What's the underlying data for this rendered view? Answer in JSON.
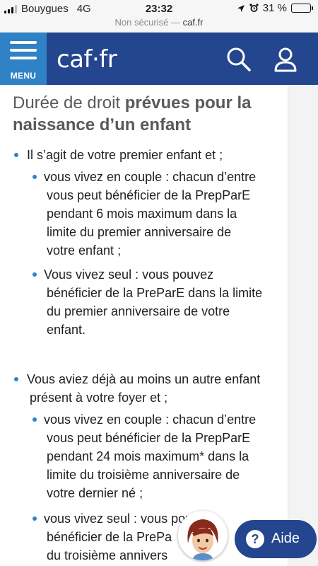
{
  "status_bar": {
    "carrier": "Bouygues",
    "network": "4G",
    "time": "23:32",
    "battery": "31 %",
    "battery_level": 0.31
  },
  "url_bar": {
    "security": "Non sécurisé —",
    "domain": "caf.fr"
  },
  "header": {
    "menu_label": "MENU",
    "logo_text": "caf·fr",
    "icons": [
      "search-icon",
      "user-account-icon"
    ],
    "brand_color": "#24468e",
    "menu_color": "#2f82c6"
  },
  "article": {
    "title_plain": "Durée de droit ",
    "title_bold_1": "prévues pour la",
    "title_bold_2": "naissance d’un enfant",
    "case1": {
      "lead": "Il s’agit de votre premier enfant et ;",
      "couple_lines": [
        "vous vivez en couple : chacun d’entre",
        "vous peut bénéficier de la PrepParE",
        "pendant 6 mois maximum dans la",
        "limite du premier anniversaire de",
        "votre enfant ;"
      ],
      "single_lines": [
        "Vous vivez seul : vous pouvez",
        "bénéficier de la PreParE dans la limite",
        "du premier anniversaire de votre",
        "enfant."
      ]
    },
    "case2": {
      "lead_lines": [
        "Vous aviez déjà au moins un autre enfant",
        "présent à votre foyer et ;"
      ],
      "couple_lines": [
        "vous vivez en couple : chacun d’entre",
        "vous peut bénéficier de la PrepParE",
        "pendant 24 mois maximum* dans la",
        "limite du troisième anniversaire de",
        "votre dernier né ;"
      ],
      "single_lines": [
        "vous vivez seul : vous pou",
        "bénéficier de la PrePa",
        "du troisième annivers"
      ]
    }
  },
  "help": {
    "label": "Aide",
    "icon": "question-icon"
  }
}
